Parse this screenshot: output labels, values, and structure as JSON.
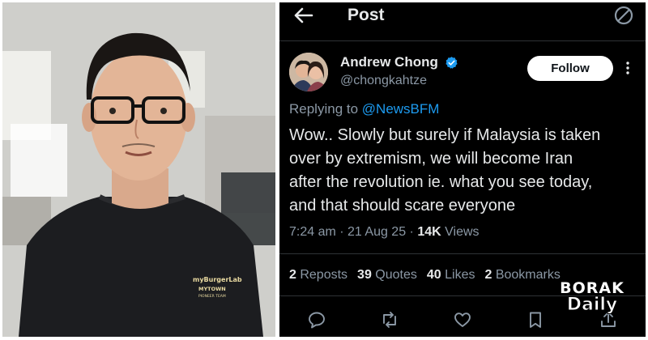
{
  "topbar": {
    "title": "Post"
  },
  "author": {
    "name": "Andrew Chong",
    "handle": "@chongkahtze",
    "follow_label": "Follow"
  },
  "reply": {
    "prefix": "Replying to ",
    "mention": "@NewsBFM"
  },
  "tweet": {
    "lines": [
      "Wow.. Slowly but surely if Malaysia is taken",
      "over by extremism, we will become Iran",
      "after the revolution ie. what you see today,",
      "and that should scare everyone"
    ]
  },
  "meta": {
    "time": "7:24 am",
    "sep1": " · ",
    "date": "21 Aug 25",
    "sep2": " · ",
    "views_count": "14K",
    "views_label": " Views"
  },
  "stats": {
    "reposts_count": "2",
    "reposts_label": " Reposts",
    "quotes_count": "39",
    "quotes_label": " Quotes",
    "likes_count": "40",
    "likes_label": " Likes",
    "bookmarks_count": "2",
    "bookmarks_label": " Bookmarks"
  },
  "watermark": {
    "line1": "BORAK",
    "line2": "Daily"
  },
  "shirt_print": {
    "line1": "myBurgerLab",
    "line2": "MYTOWN",
    "line3": "PIONEER TEAM"
  },
  "icons": [
    "back-arrow-icon",
    "no-entry-icon",
    "verified-badge-icon",
    "more-options-icon",
    "reply-icon",
    "repost-icon",
    "like-icon",
    "bookmark-icon",
    "share-icon"
  ],
  "colors": {
    "accent": "#1d9bf0",
    "follow_bg": "#ffffff",
    "muted": "#8b98a5",
    "background": "#000000"
  }
}
